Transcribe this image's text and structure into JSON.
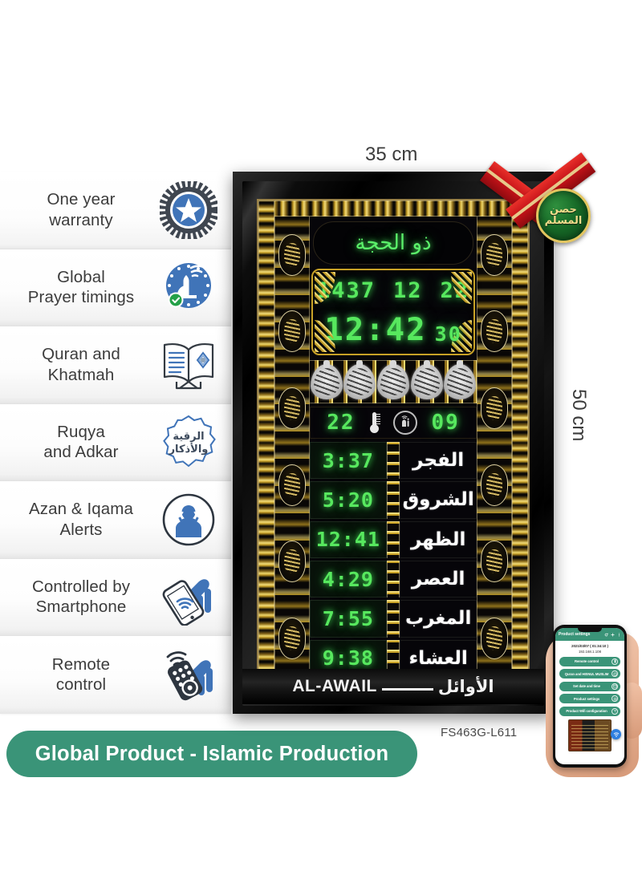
{
  "dimensions": {
    "width_label": "35 cm",
    "height_label": "50 cm"
  },
  "features": [
    {
      "label": "One year\nwarranty",
      "icon": "warranty-badge-icon"
    },
    {
      "label": "Global\nPrayer timings",
      "icon": "globe-prayer-icon"
    },
    {
      "label": "Quran and\nKhatmah",
      "icon": "open-book-icon"
    },
    {
      "label": "Ruqya\nand Adkar",
      "icon": "ruqya-seal-icon"
    },
    {
      "label": "Azan & Iqama\nAlerts",
      "icon": "muezzin-icon"
    },
    {
      "label": "Controlled by\nSmartphone",
      "icon": "smartphone-hand-icon"
    },
    {
      "label": "Remote\ncontrol",
      "icon": "remote-control-icon"
    }
  ],
  "banner": {
    "text": "Global Product - Islamic Production",
    "color": "#3a9478"
  },
  "product_code": "FS463G-L611",
  "badge": {
    "text_line1": "حصن",
    "text_line2": "المسلم",
    "ribbon_color": "#c41218",
    "badge_color": "#186b28"
  },
  "clock": {
    "hijri_month": "ذو الحجة",
    "hijri_date": [
      "1437",
      "12",
      "22"
    ],
    "time": "12:42",
    "seconds": "30",
    "temperature": "22",
    "counter": "09",
    "led_color": "#57e85e",
    "prayers": [
      {
        "name": "الفجر",
        "time": "3:37"
      },
      {
        "name": "الشروق",
        "time": "5:20"
      },
      {
        "name": "الظهر",
        "time": "12:41"
      },
      {
        "name": "العصر",
        "time": "4:29"
      },
      {
        "name": "المغرب",
        "time": "7:55"
      },
      {
        "name": "العشاء",
        "time": "9:38"
      }
    ],
    "brand_en": "AL-AWAIL",
    "brand_ar": "الأوائل"
  },
  "phone": {
    "app_title": "Product settings",
    "datetime": "2021/03/07 ( 01:34:10 )",
    "ip": "192.168.1.108",
    "buttons": [
      {
        "label": "Remote control",
        "icon": "remote-icon"
      },
      {
        "label": "Quran and HISNUL MUSLIM",
        "icon": "quran-icon"
      },
      {
        "label": "Set date and time",
        "icon": "calendar-icon"
      },
      {
        "label": "Product settings",
        "icon": "gear-icon"
      },
      {
        "label": "Product Wifi configuration",
        "icon": "wifi-gear-icon"
      }
    ]
  }
}
